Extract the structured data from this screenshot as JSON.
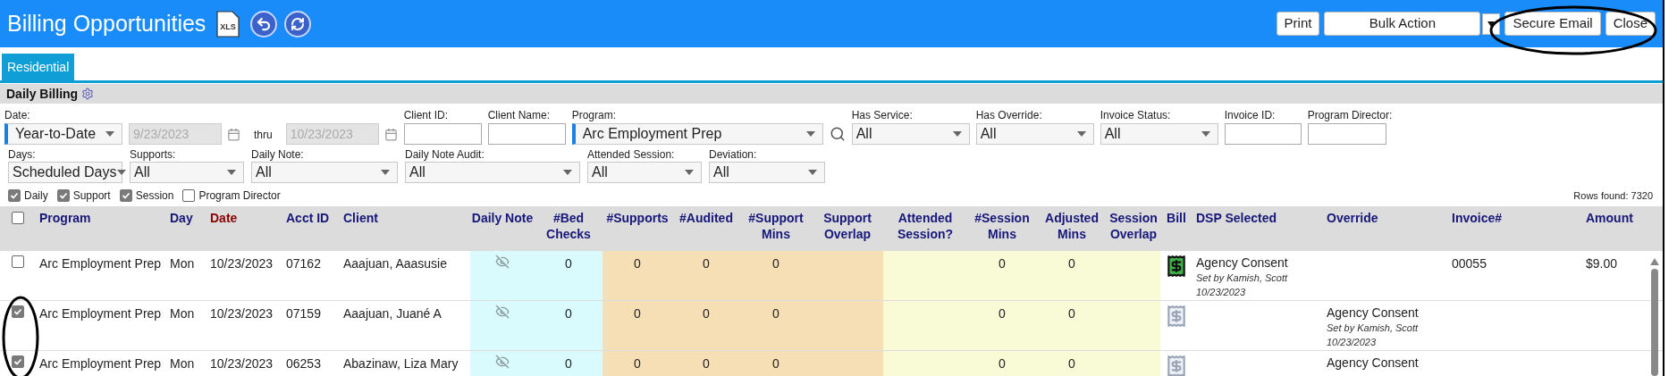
{
  "header": {
    "title": "Billing Opportunities",
    "xls_label": "XLS",
    "buttons": [
      {
        "label": "Print",
        "kind": "button"
      },
      {
        "label": "Bulk Action",
        "kind": "dropdown"
      },
      {
        "label": "Secure Email",
        "kind": "button"
      },
      {
        "label": "Close",
        "kind": "button"
      }
    ]
  },
  "tabs": [
    {
      "label": "Residential",
      "selected": true
    }
  ],
  "section": {
    "title": "Daily Billing"
  },
  "filters_row1": [
    {
      "kind": "select",
      "label": "Date:",
      "value": "Year-to-Date",
      "required": true
    },
    {
      "kind": "date",
      "value": "9/23/2023",
      "disabled": true
    },
    {
      "kind": "text",
      "value": "thru"
    },
    {
      "kind": "date",
      "value": "10/23/2023",
      "disabled": true
    },
    {
      "kind": "input",
      "label": "Client ID:"
    },
    {
      "kind": "input",
      "label": "Client Name:"
    },
    {
      "kind": "select",
      "label": "Program:",
      "value": "Arc Employment Prep",
      "required": true
    },
    {
      "kind": "search"
    },
    {
      "kind": "select",
      "label": "Has Service:",
      "value": "All",
      "required": false
    },
    {
      "kind": "select",
      "label": "Has Override:",
      "value": "All",
      "required": false
    },
    {
      "kind": "select",
      "label": "Invoice Status:",
      "value": "All",
      "required": false
    },
    {
      "kind": "input",
      "label": "Invoice ID:"
    },
    {
      "kind": "input",
      "label": "Program Director:"
    }
  ],
  "filters_row2": [
    {
      "label": "Days:",
      "value": "Scheduled Days"
    },
    {
      "label": "Supports:",
      "value": "All"
    },
    {
      "label": "Daily Note:",
      "value": "All"
    },
    {
      "label": "Daily Note Audit:",
      "value": "All"
    },
    {
      "label": "Attended Session:",
      "value": "All"
    },
    {
      "label": "Deviation:",
      "value": "All"
    }
  ],
  "toggles": [
    {
      "label": "Daily",
      "checked": true
    },
    {
      "label": "Support",
      "checked": true
    },
    {
      "label": "Session",
      "checked": true
    },
    {
      "label": "Program Director",
      "checked": false
    }
  ],
  "rows_found": "Rows found: 7320",
  "table": {
    "select_all": false,
    "columns": [
      {
        "label": "Program",
        "sorted": false
      },
      {
        "label": "Day",
        "sorted": false
      },
      {
        "label": "Date",
        "sorted": true
      },
      {
        "label": "Acct ID",
        "sorted": false
      },
      {
        "label": "Client",
        "sorted": false
      },
      {
        "label": "Daily Note",
        "sorted": false
      },
      {
        "label": "#Bed Checks",
        "sorted": false
      },
      {
        "label": "#Supports",
        "sorted": false
      },
      {
        "label": "#Audited",
        "sorted": false
      },
      {
        "label": "#Support Mins",
        "sorted": false
      },
      {
        "label": "Support Overlap",
        "sorted": false
      },
      {
        "label": "Attended Session?",
        "sorted": false
      },
      {
        "label": "#Session Mins",
        "sorted": false
      },
      {
        "label": "Adjusted Mins",
        "sorted": false
      },
      {
        "label": "Session Overlap",
        "sorted": false
      },
      {
        "label": "Bill",
        "sorted": false
      },
      {
        "label": "DSP Selected",
        "sorted": false
      },
      {
        "label": "Override",
        "sorted": false
      },
      {
        "label": "Invoice#",
        "sorted": false
      },
      {
        "label": "Amount",
        "sorted": false
      }
    ],
    "rows": [
      {
        "selected": false,
        "program": "Arc Employment Prep",
        "day": "Mon",
        "date": "10/23/2023",
        "acct_id": "07162",
        "client": "Aaajuan, Aaasusie",
        "bed_checks": "0",
        "supports": "0",
        "audited": "0",
        "support_mins": "0",
        "session_mins": "0",
        "adjusted_mins": "0",
        "billed": true,
        "dsp_selected": {
          "text": "Agency Consent",
          "set_by": "Set by Kamish, Scott",
          "date": "10/23/2023"
        },
        "invoice": "00055",
        "amount": "$9.00"
      },
      {
        "selected": true,
        "program": "Arc Employment Prep",
        "day": "Mon",
        "date": "10/23/2023",
        "acct_id": "07159",
        "client": "Aaajuan, Juané A",
        "bed_checks": "0",
        "supports": "0",
        "audited": "0",
        "support_mins": "0",
        "session_mins": "0",
        "adjusted_mins": "0",
        "billed": false,
        "override": {
          "text": "Agency Consent",
          "set_by": "Set by Kamish, Scott",
          "date": "10/23/2023"
        }
      },
      {
        "selected": true,
        "program": "Arc Employment Prep",
        "day": "Mon",
        "date": "10/23/2023",
        "acct_id": "06253",
        "client": "Abazinaw, Liza Mary",
        "bed_checks": "0",
        "supports": "0",
        "audited": "0",
        "support_mins": "0",
        "session_mins": "0",
        "adjusted_mins": "0",
        "billed": false,
        "override": {
          "text": "Agency Consent"
        }
      }
    ]
  }
}
